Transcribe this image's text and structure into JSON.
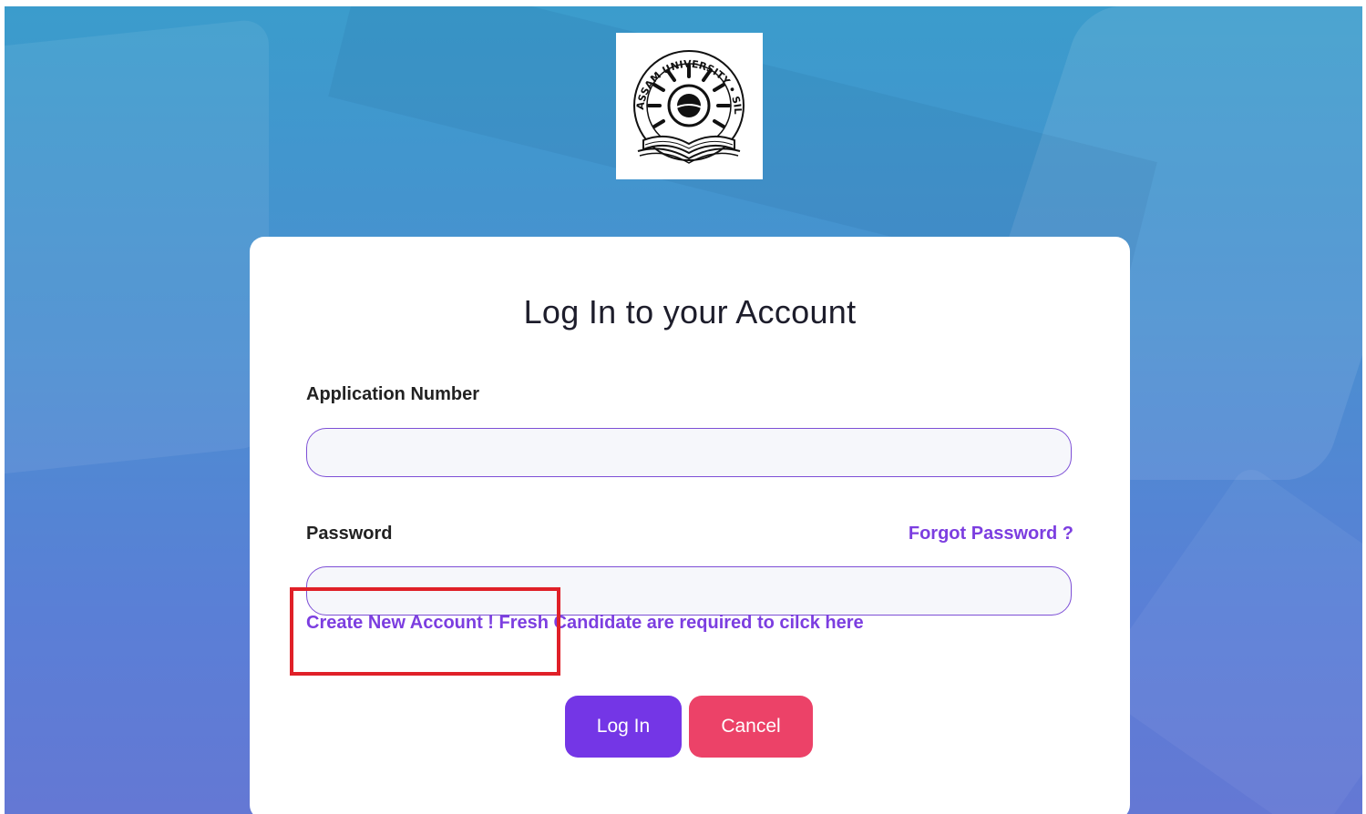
{
  "page": {
    "title": "Log In to your Account"
  },
  "logo": {
    "alt_text": "Assam University Silchar",
    "seal_top_text": "ASSAM UNIVERSITY • SILCHAR"
  },
  "form": {
    "application_number": {
      "label": "Application Number",
      "value": "",
      "placeholder": ""
    },
    "password": {
      "label": "Password",
      "value": "",
      "placeholder": ""
    },
    "forgot_password_label": "Forgot Password ?",
    "create_account_label": "Create New Account ! Fresh Candidate are required to cilck here"
  },
  "buttons": {
    "login_label": "Log In",
    "cancel_label": "Cancel"
  },
  "colors": {
    "accent_purple": "#7436e6",
    "link_purple": "#7c3ee0",
    "cancel_pink": "#ec4268",
    "highlight_red": "#e02028",
    "input_border": "#7d4fd6"
  },
  "icons": {
    "logo": "university-seal-icon"
  }
}
